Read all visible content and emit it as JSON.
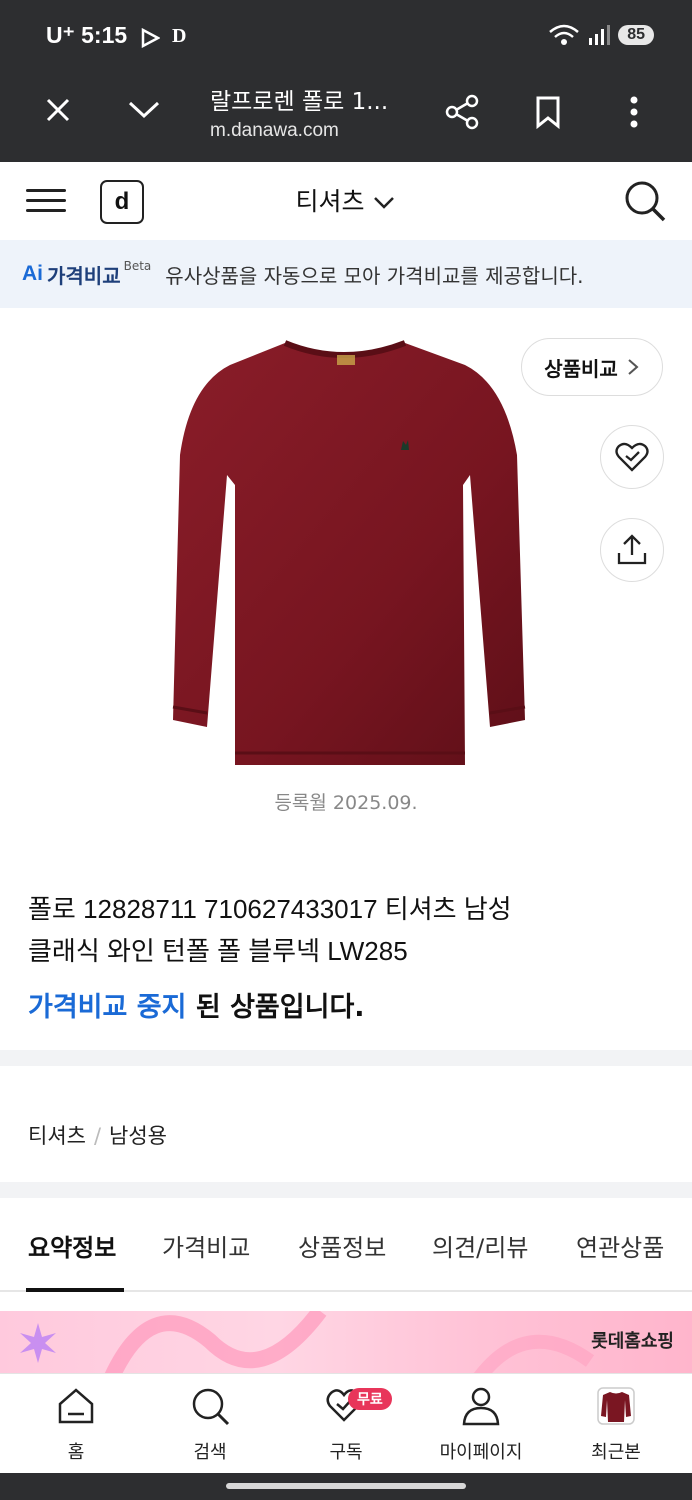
{
  "status_bar": {
    "time": "5:15",
    "carrier": "U⁺",
    "battery": "85",
    "icons": [
      "play-icon",
      "d-app-icon",
      "wifi-icon",
      "signal-icon"
    ]
  },
  "browser": {
    "title": "랄프로렌 폴로 1...",
    "url": "m.danawa.com"
  },
  "header": {
    "logo": "d",
    "category": "티셔츠"
  },
  "ai_bar": {
    "ai": "Ai",
    "label": "가격비교",
    "beta": "Beta",
    "text": "유사상품을 자동으로 모아 가격비교를 제공합니다."
  },
  "product": {
    "compare_label": "상품비교",
    "registered": "등록월 2025.09.",
    "name_line1": "폴로 12828711 710627433017 티셔츠 남성",
    "name_line2": "클래식 와인 턴폴 폴 블루넥 LW285",
    "notice_blue": "가격비교 중지",
    "notice_rest": " 된 상품입니다.",
    "image_color": "#7a1622"
  },
  "breadcrumb": [
    "티셔츠",
    "남성용"
  ],
  "tabs": [
    "요약정보",
    "가격비교",
    "상품정보",
    "의견/리뷰",
    "연관상품"
  ],
  "banner": {
    "brand": "롯데홈쇼핑"
  },
  "bottom_nav": [
    {
      "label": "홈",
      "icon": "home-icon"
    },
    {
      "label": "검색",
      "icon": "search-icon"
    },
    {
      "label": "구독",
      "icon": "heart-check-icon",
      "badge": "무료"
    },
    {
      "label": "마이페이지",
      "icon": "person-icon"
    },
    {
      "label": "최근본",
      "icon": "recent-thumbnail"
    }
  ],
  "colors": {
    "accent": "#1a6ad6",
    "dark_bar": "#2d2e30"
  }
}
